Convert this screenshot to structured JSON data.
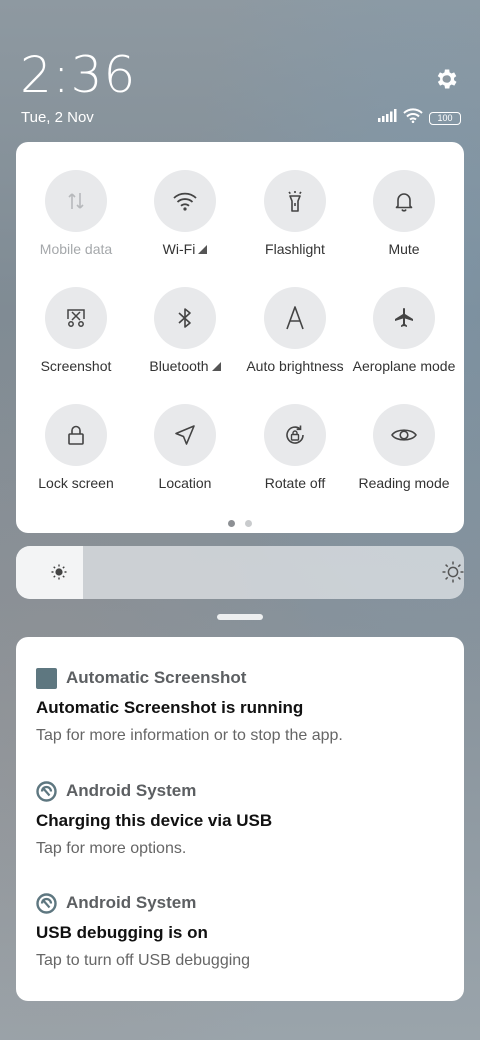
{
  "header": {
    "time": "2:36",
    "date": "Tue, 2 Nov",
    "battery_level": "100",
    "settings_icon": "gear-icon"
  },
  "tiles": [
    {
      "label": "Mobile data",
      "icon": "mobile-data-icon",
      "enabled": false
    },
    {
      "label": "Wi-Fi",
      "icon": "wifi-icon",
      "enabled": true,
      "has_submenu": true
    },
    {
      "label": "Flashlight",
      "icon": "flashlight-icon",
      "enabled": true
    },
    {
      "label": "Mute",
      "icon": "bell-icon",
      "enabled": true
    },
    {
      "label": "Screenshot",
      "icon": "screenshot-icon",
      "enabled": true
    },
    {
      "label": "Bluetooth",
      "icon": "bluetooth-icon",
      "enabled": true,
      "has_submenu": true
    },
    {
      "label": "Auto brightness",
      "icon": "auto-brightness-icon",
      "enabled": true
    },
    {
      "label": "Aeroplane mode",
      "icon": "airplane-icon",
      "enabled": true
    },
    {
      "label": "Lock screen",
      "icon": "lock-icon",
      "enabled": true
    },
    {
      "label": "Location",
      "icon": "location-icon",
      "enabled": true
    },
    {
      "label": "Rotate off",
      "icon": "rotate-lock-icon",
      "enabled": true
    },
    {
      "label": "Reading mode",
      "icon": "eye-icon",
      "enabled": true
    }
  ],
  "pager": {
    "pages": 2,
    "current": 1
  },
  "brightness": {
    "level_percent": 15
  },
  "notifications": [
    {
      "app": "Automatic Screenshot",
      "app_icon": "app-square-icon",
      "title": "Automatic Screenshot is running",
      "body": "Tap for more information or to stop the app."
    },
    {
      "app": "Android System",
      "app_icon": "android-system-icon",
      "title": "Charging this device via USB",
      "body": "Tap for more options."
    },
    {
      "app": "Android System",
      "app_icon": "android-system-icon",
      "title": "USB debugging is on",
      "body": "Tap to turn off USB debugging"
    }
  ],
  "colors": {
    "panel_bg": "#ffffff",
    "tile_circle": "#e8e9eb",
    "app_square": "#5e7780",
    "icon_gray": "#555555"
  }
}
